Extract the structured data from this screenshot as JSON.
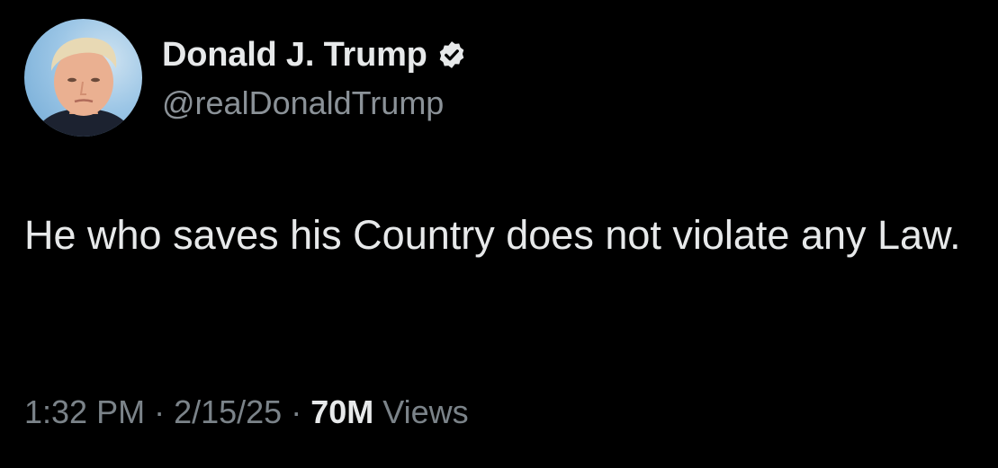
{
  "author": {
    "display_name": "Donald J. Trump",
    "handle": "@realDonaldTrump",
    "verified": true,
    "verified_badge_color": "#e7e9ea"
  },
  "tweet": {
    "text": "He who saves his Country does not violate any Law."
  },
  "meta": {
    "time": "1:32 PM",
    "separator": "·",
    "date": "2/15/25",
    "views_count": "70M",
    "views_label": "Views"
  },
  "icons": {
    "avatar": "profile-photo",
    "badge": "verified-badge-icon"
  },
  "colors": {
    "background": "#000000",
    "primary_text": "#e7e9ea",
    "secondary_text": "#7b8389"
  }
}
